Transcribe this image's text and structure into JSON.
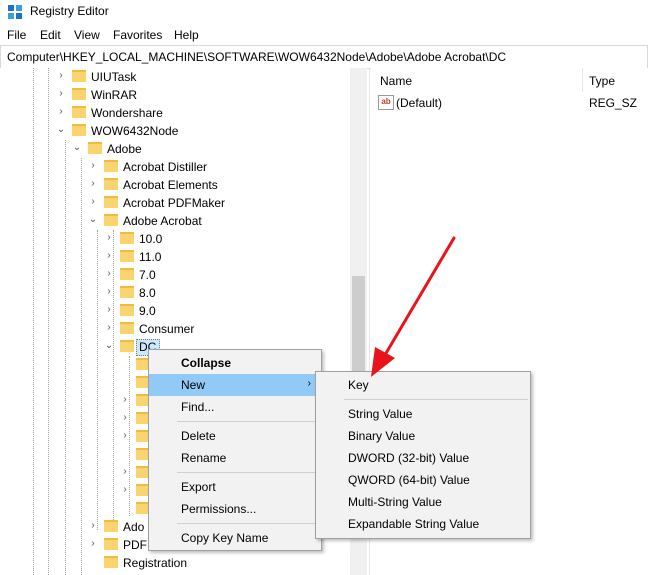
{
  "window": {
    "title": "Registry Editor"
  },
  "menu": [
    "File",
    "Edit",
    "View",
    "Favorites",
    "Help"
  ],
  "address": "Computer\\HKEY_LOCAL_MACHINE\\SOFTWARE\\WOW6432Node\\Adobe\\Adobe Acrobat\\DC",
  "tree": {
    "nodes": [
      {
        "label": "UIUTask"
      },
      {
        "label": "WinRAR"
      },
      {
        "label": "Wondershare"
      },
      {
        "label": "WOW6432Node"
      },
      {
        "label": "Adobe"
      },
      {
        "label": "Acrobat Distiller"
      },
      {
        "label": "Acrobat Elements"
      },
      {
        "label": "Acrobat PDFMaker"
      },
      {
        "label": "Adobe Acrobat"
      },
      {
        "label": "10.0"
      },
      {
        "label": "11.0"
      },
      {
        "label": "7.0"
      },
      {
        "label": "8.0"
      },
      {
        "label": "9.0"
      },
      {
        "label": "Consumer"
      },
      {
        "label": "DC"
      },
      {
        "label": "Ado"
      },
      {
        "label": "PDF"
      },
      {
        "label": "Registration"
      }
    ]
  },
  "values_pane": {
    "columns": [
      "Name",
      "Type"
    ],
    "rows": [
      {
        "name": "(Default)",
        "type": "REG_SZ",
        "icon": "ab"
      }
    ]
  },
  "context_menu": {
    "items": [
      "Collapse",
      "New",
      "Find...",
      "Delete",
      "Rename",
      "Export",
      "Permissions...",
      "Copy Key Name"
    ]
  },
  "submenu": {
    "items": [
      "Key",
      "String Value",
      "Binary Value",
      "DWORD (32-bit) Value",
      "QWORD (64-bit) Value",
      "Multi-String Value",
      "Expandable String Value"
    ]
  },
  "colors": {
    "highlight": "#91c9f7",
    "arrow": "#e8141a",
    "folder": "#f9d46f"
  }
}
